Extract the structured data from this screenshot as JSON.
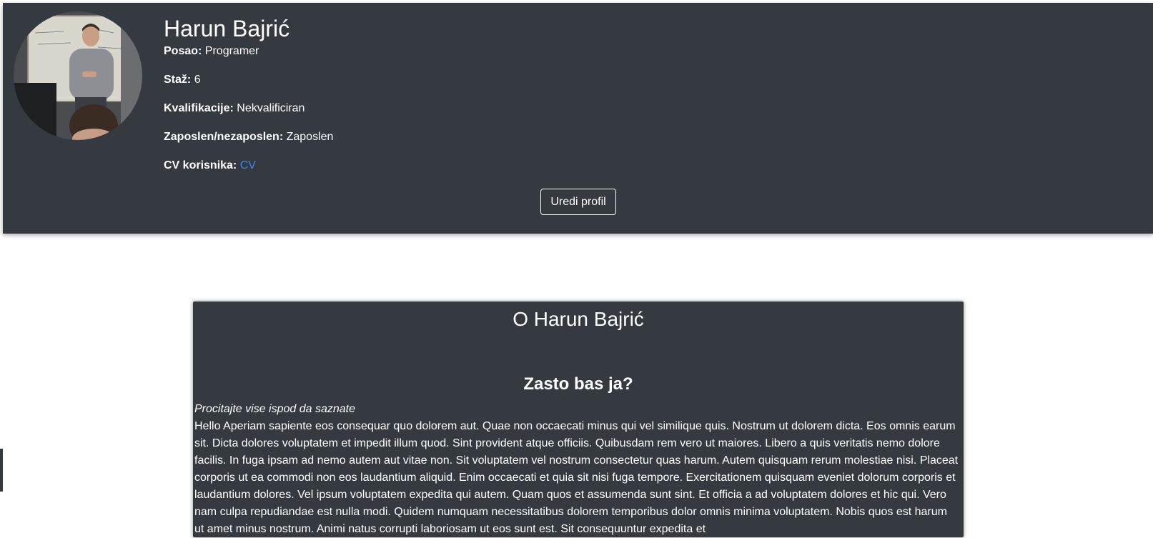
{
  "profile": {
    "name": "Harun Bajrić",
    "avatar_alt": "Harun Bajrić",
    "fields": {
      "job_label": "Posao:",
      "job_value": "Programer",
      "experience_label": "Staž:",
      "experience_value": "6",
      "qualification_label": "Kvalifikacije:",
      "qualification_value": "Nekvalificiran",
      "employment_label": "Zaposlen/nezaposlen:",
      "employment_value": "Zaposlen",
      "cv_label": "CV korisnika:",
      "cv_link": "CV"
    },
    "edit_button": "Uredi profil"
  },
  "about": {
    "title": "O Harun Bajrić",
    "why_title": "Zasto bas ja?",
    "subtitle": "Procitajte vise ispod da saznate",
    "bio": "Hello Aperiam sapiente eos consequar quo dolorem aut. Quae non occaecati minus qui vel similique quis. Nostrum ut dolorem dicta. Eos omnis earum sit. Dicta dolores voluptatem et impedit illum quod. Sint provident atque officiis. Quibusdam rem vero ut maiores. Libero a quis veritatis nemo dolore facilis. In fuga ipsam ad nemo autem aut vitae non. Sit voluptatem vel nostrum consectetur quas harum. Autem quisquam rerum molestiae nisi. Placeat corporis ut ea commodi non eos laudantium aliquid. Enim occaecati et quia sit nisi fuga tempore. Exercitationem quisquam eveniet dolorum corporis et laudantium dolores. Vel ipsum voluptatem expedita qui autem. Quam quos et assumenda sunt sint. Et officia a ad voluptatem dolores et hic qui. Vero nam culpa repudiandae est nulla modi. Quidem numquam necessitatibus dolorem temporibus dolor omnis minima voluptatem. Nobis quos est harum ut amet minus nostrum. Animi natus corrupti laboriosam ut eos sunt est. Sit consequuntur expedita et"
  },
  "colors": {
    "panel_background": "#343a40",
    "link": "#2f86ff",
    "text": "#ffffff",
    "page_background": "#ffffff"
  }
}
